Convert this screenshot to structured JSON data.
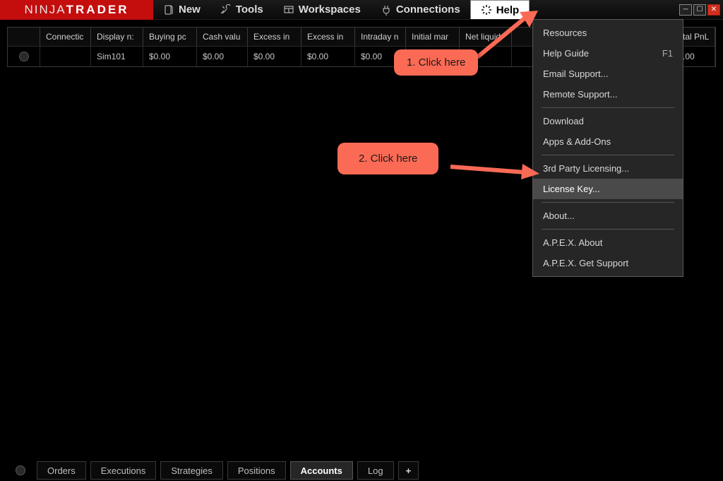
{
  "logo": {
    "left": "NINJA",
    "right": "TRADER"
  },
  "menubar": {
    "new": "New",
    "tools": "Tools",
    "workspaces": "Workspaces",
    "connections": "Connections",
    "help": "Help"
  },
  "help_menu": {
    "resources": "Resources",
    "help_guide": "Help Guide",
    "help_guide_shortcut": "F1",
    "email_support": "Email Support...",
    "remote_support": "Remote Support...",
    "download": "Download",
    "apps_addons": "Apps & Add-Ons",
    "third_party_licensing": "3rd Party Licensing...",
    "license_key": "License Key...",
    "about": "About...",
    "apex_about": "A.P.E.X. About",
    "apex_support": "A.P.E.X. Get Support"
  },
  "table": {
    "columns": [
      "",
      "Connectic",
      "Display n:",
      "Buying pc",
      "Cash valu",
      "Excess in",
      "Excess in",
      "Intraday n",
      "Initial mar",
      "Net liquid",
      "",
      "tal PnL"
    ],
    "row": {
      "display_name": "Sim101",
      "buying_power": "$0.00",
      "cash_value": "$0.00",
      "excess1": "$0.00",
      "excess2": "$0.00",
      "intraday": "$0.00",
      "initial_margin_partial": "$",
      "total_pnl": ".00"
    }
  },
  "tabs": {
    "orders": "Orders",
    "executions": "Executions",
    "strategies": "Strategies",
    "positions": "Positions",
    "accounts": "Accounts",
    "log": "Log",
    "add": "+"
  },
  "annotations": {
    "callout1": "1. Click here",
    "callout2": "2. Click here"
  }
}
